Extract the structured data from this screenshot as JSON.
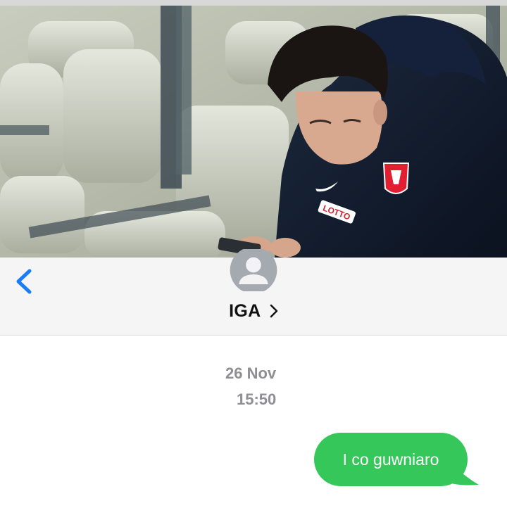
{
  "photo": {
    "shirt_text": "LOTTO"
  },
  "header": {
    "back_icon": "chevron-left-icon",
    "avatar_icon": "person-silhouette-icon",
    "contact_name": "IGA",
    "contact_chevron": "›",
    "accent_color": "#1a7cf6"
  },
  "conversation": {
    "date": "26 Nov",
    "time": "15:50",
    "messages": [
      {
        "direction": "sent",
        "text": "I co guwniaro",
        "color": "#35c759"
      }
    ]
  }
}
